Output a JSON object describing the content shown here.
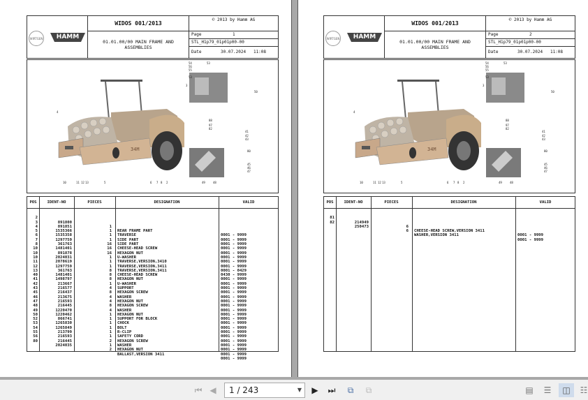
{
  "viewer": {
    "page_indicator": "1 / 243",
    "icons": [
      "first-page-icon",
      "previous-page-icon",
      "next-page-icon",
      "last-page-icon",
      "go-back-view-icon",
      "go-forward-view-icon",
      "single-page-view-icon",
      "continuous-view-icon",
      "two-page-view-icon",
      "two-page-continuous-view-icon"
    ]
  },
  "pages": [
    {
      "title": "WIDOS 001/2013",
      "copyright": "© 2013 by Hamm AG",
      "brand": "HAMM",
      "group_logo": "WIRTGEN GROUP",
      "subtitle_line1": "01.01.00/00 MAIN FRAME AND",
      "subtitle_line2": "ASSEMBLIES",
      "page_label": "Page",
      "page_no": "1",
      "doc_code": "STL_H1p79_01p01p00-00",
      "date_label": "Date",
      "date": "30.07.2024   11:08",
      "callouts": [
        "54",
        "53",
        "56",
        "55",
        "53",
        "50",
        "3",
        "4",
        "88",
        "97",
        "82",
        "41",
        "42",
        "43",
        "80",
        "45",
        "46",
        "47",
        "49",
        "48",
        "10",
        "11",
        "12",
        "13",
        "5",
        "6",
        "7",
        "8",
        "2"
      ],
      "columns": [
        "POS",
        "IDENT-NO",
        "PIECES",
        "DESIGNATION",
        "VALID"
      ],
      "rows": [
        [
          "2",
          "891800",
          "1",
          "REAR FRAME PART",
          "0001 - 9999"
        ],
        [
          "3",
          "891851",
          "1",
          "TRAVERSE",
          "0001 - 9999"
        ],
        [
          "4",
          "1535366",
          "1",
          "SIDE PART",
          "0001 - 9999"
        ],
        [
          "5",
          "1535358",
          "1",
          "SIDE PART",
          "0001 - 9999"
        ],
        [
          "6",
          "1297759",
          "16",
          "CHEESE-HEAD SCREW",
          "0001 - 9999"
        ],
        [
          "7",
          "361763",
          "16",
          "HEXAGON NUT",
          "0001 - 9999"
        ],
        [
          "8",
          "1481401",
          "16",
          "U-WASHER",
          "0001 - 9999"
        ],
        [
          "10",
          "891878",
          "1",
          "TRAVERSE,VERSION,3410",
          "0001 - 9999"
        ],
        [
          "10",
          "2024031",
          "1",
          "TRAVERSE,VERSION,3411",
          "0001 - 0429"
        ],
        [
          "10",
          "2078619",
          "1",
          "TRAVERSE,VERSION,3411",
          "0430 - 9999"
        ],
        [
          "11",
          "1297759",
          "8",
          "CHEESE-HEAD SCREW",
          "0001 - 9999"
        ],
        [
          "12",
          "361763",
          "8",
          "HEXAGON NUT",
          "0001 - 9999"
        ],
        [
          "13",
          "1481401",
          "8",
          "U-WASHER",
          "0001 - 9999"
        ],
        [
          "40",
          "1498797",
          "1",
          "SUPPORT",
          "0001 - 9999"
        ],
        [
          "41",
          "213667",
          "4",
          "HEXAGON SCREW",
          "0001 - 9999"
        ],
        [
          "42",
          "216577",
          "8",
          "WASHER",
          "0001 - 9999"
        ],
        [
          "43",
          "216437",
          "4",
          "HEXAGON NUT",
          "0001 - 9999"
        ],
        [
          "45",
          "213675",
          "4",
          "HEXAGON SCREW",
          "0001 - 9999"
        ],
        [
          "46",
          "216593",
          "8",
          "WASHER",
          "0001 - 9999"
        ],
        [
          "47",
          "216445",
          "4",
          "HEXAGON NUT",
          "0001 - 9999"
        ],
        [
          "48",
          "1220470",
          "1",
          "SUPPORT FOR BLOCK",
          "0001 - 9999"
        ],
        [
          "49",
          "1220462",
          "1",
          "CHOCK",
          "0001 - 9999"
        ],
        [
          "50",
          "866741",
          "1",
          "BOLT",
          "0001 - 9999"
        ],
        [
          "52",
          "1265830",
          "1",
          "R-CLIP",
          "0001 - 9999"
        ],
        [
          "53",
          "1265849",
          "1",
          "SAFETY CORD",
          "0001 - 9999"
        ],
        [
          "54",
          "213799",
          "1",
          "HEXAGON SCREW",
          "0001 - 9999"
        ],
        [
          "55",
          "216593",
          "2",
          "WASHER",
          "0001 - 9999"
        ],
        [
          "56",
          "216445",
          "1",
          "HEXAGON NUT",
          "0001 - 9999"
        ],
        [
          "80",
          "2024035",
          "2",
          "BALLAST,VERSION 3411",
          "0001 - 9999"
        ]
      ]
    },
    {
      "title": "WIDOS 001/2013",
      "copyright": "© 2013 by Hamm AG",
      "brand": "HAMM",
      "group_logo": "WIRTGEN GROUP",
      "subtitle_line1": "01.01.00/00 MAIN FRAME AND",
      "subtitle_line2": "ASSEMBLIES",
      "page_label": "Page",
      "page_no": "2",
      "doc_code": "STL_H1p79_01p01p00-00",
      "date_label": "Date",
      "date": "30.07.2024   11:08",
      "callouts": [
        "54",
        "53",
        "56",
        "55",
        "53",
        "50",
        "3",
        "4",
        "88",
        "97",
        "82",
        "41",
        "42",
        "43",
        "80",
        "45",
        "46",
        "47",
        "49",
        "48",
        "10",
        "11",
        "12",
        "13",
        "5",
        "6",
        "7",
        "8",
        "2"
      ],
      "columns": [
        "POS",
        "IDENT-NO",
        "PIECES",
        "DESIGNATION",
        "VALID"
      ],
      "rows": [
        [
          "81",
          "214949",
          "6",
          "CHEESE-HEAD SCREW,VERSION 3411",
          "0001 - 9999"
        ],
        [
          "82",
          "250473",
          "6",
          "WASHER,VERSION 3411",
          "0001 - 9999"
        ]
      ]
    }
  ]
}
